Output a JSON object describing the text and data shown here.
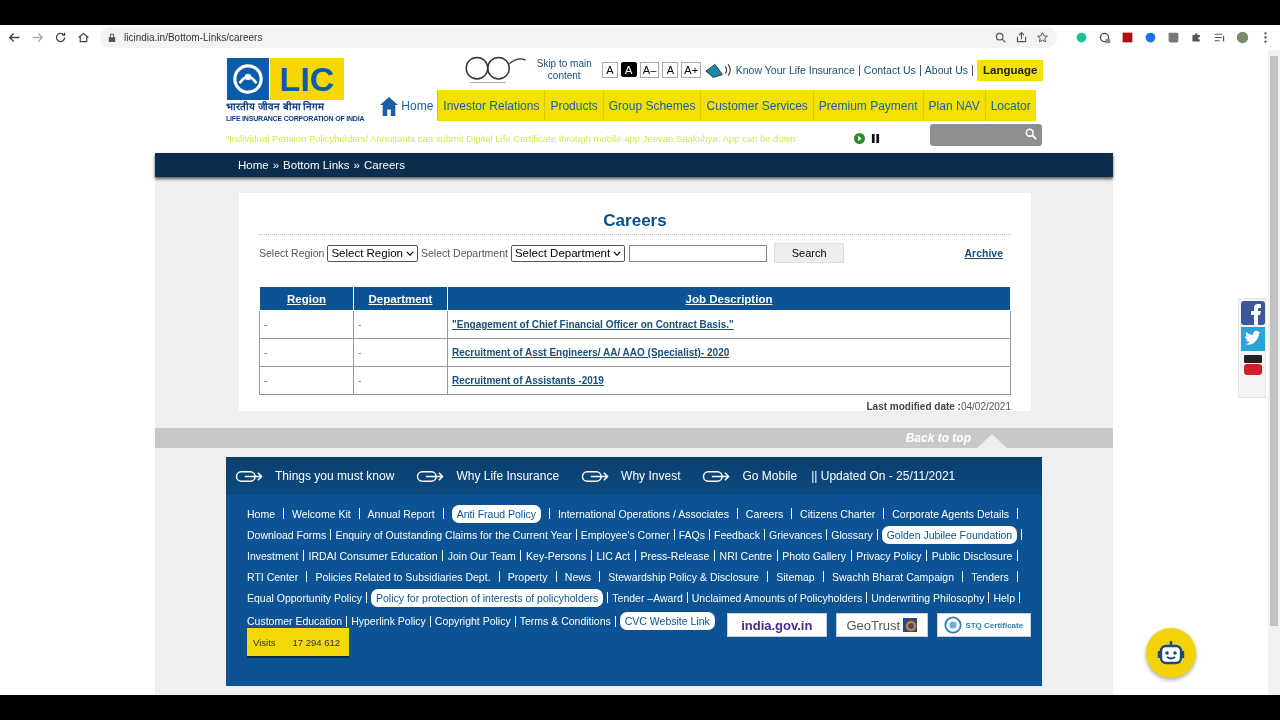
{
  "browser": {
    "url": "licindia.in/Bottom-Links/careers"
  },
  "header": {
    "logo": {
      "brand": "LIC",
      "hindi": "भारतीय जीवन बीमा निगम",
      "english": "LIFE INSURANCE CORPORATION OF INDIA"
    },
    "skip_link": "Skip to main content",
    "font_sizes": [
      {
        "label": "A",
        "selected": false
      },
      {
        "label": "A",
        "selected": true
      },
      {
        "label": "A–",
        "selected": false
      },
      {
        "label": "A",
        "selected": false
      },
      {
        "label": "A+",
        "selected": false
      }
    ],
    "top_links": [
      "Know Your Life Insurance",
      "Contact Us",
      "About Us"
    ],
    "language_button": "Language",
    "nav": [
      {
        "label": "Home",
        "kind": "home"
      },
      {
        "label": "Investor Relations",
        "kind": "tab"
      },
      {
        "label": "Products",
        "kind": "tab"
      },
      {
        "label": "Group Schemes",
        "kind": "tab"
      },
      {
        "label": "Customer Services",
        "kind": "tab"
      },
      {
        "label": "Premium Payment",
        "kind": "tab"
      },
      {
        "label": "Plan NAV",
        "kind": "tab"
      },
      {
        "label": "Locator",
        "kind": "tab"
      }
    ],
    "marquee": "“Individual Pension Policyholders/ Annuitants can submit Digital Life Certificate through mobile app Jeevan Saakshya. App can be down"
  },
  "breadcrumb": {
    "items": [
      "Home",
      "Bottom Links",
      "Careers"
    ],
    "separator": "»"
  },
  "careers": {
    "title": "Careers",
    "region_label": "Select Region",
    "region_select": "Select Region",
    "department_label": "Select Department",
    "department_select": "Select Department",
    "search_button": "Search",
    "archive_link": "Archive",
    "columns": [
      "Region",
      "Department",
      "Job Description"
    ],
    "rows": [
      {
        "region": "-",
        "department": "-",
        "job": "\"Engagement of Chief Financial Officer on Contract Basis.\""
      },
      {
        "region": "-",
        "department": "-",
        "job": "Recruitment of Asst Engineers/ AA/ AAO (Specialist)- 2020"
      },
      {
        "region": "-",
        "department": "-",
        "job": "Recruitment of Assistants -2019"
      }
    ],
    "last_modified_label": "Last modified date :",
    "last_modified": "04/02/2021"
  },
  "back_to_top": "Back to top",
  "footer": {
    "quick_links": [
      "Things you must know",
      "Why Life Insurance",
      "Why Invest",
      "Go Mobile"
    ],
    "updated": "|| Updated On - 25/11/2021",
    "link_rows": [
      [
        {
          "label": "Home",
          "highlighted": false
        },
        {
          "label": "Welcome Kit",
          "highlighted": false
        },
        {
          "label": "Annual Report",
          "highlighted": false
        },
        {
          "label": "Anti Fraud Policy",
          "highlighted": true
        },
        {
          "label": "International Operations / Associates",
          "highlighted": false
        },
        {
          "label": "Careers",
          "highlighted": false
        },
        {
          "label": "Citizens Charter",
          "highlighted": false
        },
        {
          "label": "Corporate Agents Details",
          "highlighted": false
        }
      ],
      [
        {
          "label": "Download Forms",
          "highlighted": false
        },
        {
          "label": "Enquiry of Outstanding Claims for the Current Year",
          "highlighted": false
        },
        {
          "label": "Employee's Corner",
          "highlighted": false
        },
        {
          "label": "FAQs",
          "highlighted": false
        },
        {
          "label": "Feedback",
          "highlighted": false
        },
        {
          "label": "Grievances",
          "highlighted": false
        },
        {
          "label": "Glossary",
          "highlighted": false
        },
        {
          "label": "Golden Jubilee Foundation",
          "highlighted": true
        }
      ],
      [
        {
          "label": "Investment",
          "highlighted": false
        },
        {
          "label": "IRDAI Consumer Education",
          "highlighted": false
        },
        {
          "label": "Join Our Team",
          "highlighted": false
        },
        {
          "label": "Key-Persons",
          "highlighted": false
        },
        {
          "label": "LIC Act",
          "highlighted": false
        },
        {
          "label": "Press-Release",
          "highlighted": false
        },
        {
          "label": "NRI Centre",
          "highlighted": false
        },
        {
          "label": "Photo Gallery",
          "highlighted": false
        },
        {
          "label": "Privacy Policy",
          "highlighted": false
        },
        {
          "label": "Public Disclosure",
          "highlighted": false
        }
      ],
      [
        {
          "label": "RTI Center",
          "highlighted": false
        },
        {
          "label": "Policies Related to Subsidiaries Dept.",
          "highlighted": false
        },
        {
          "label": "Property",
          "highlighted": false
        },
        {
          "label": "News",
          "highlighted": false
        },
        {
          "label": "Stewardship Policy & Disclosure",
          "highlighted": false
        },
        {
          "label": "Sitemap",
          "highlighted": false
        },
        {
          "label": "Swachh Bharat Campaign",
          "highlighted": false
        },
        {
          "label": "Tenders",
          "highlighted": false
        }
      ],
      [
        {
          "label": "Equal Opportunity Policy",
          "highlighted": false
        },
        {
          "label": "Policy for protection of interests of policyholders",
          "highlighted": true
        },
        {
          "label": "Tender –Award",
          "highlighted": false
        },
        {
          "label": "Unclaimed Amounts of Policyholders",
          "highlighted": false
        },
        {
          "label": "Underwriting Philosophy",
          "highlighted": false
        },
        {
          "label": "Help",
          "highlighted": false
        }
      ],
      [
        {
          "label": "Customer Education",
          "highlighted": false
        },
        {
          "label": "Hyperlink Policy",
          "highlighted": false
        },
        {
          "label": "Copyright Policy",
          "highlighted": false
        },
        {
          "label": "Terms & Conditions",
          "highlighted": false
        },
        {
          "label": "CVC Website Link",
          "highlighted": true
        }
      ]
    ],
    "visits": {
      "label": "Visits",
      "count": "17 294 612"
    },
    "badges": [
      {
        "kind": "india_gov",
        "text": "india.gov.in"
      },
      {
        "kind": "geotrust",
        "text": "GeoTrust"
      },
      {
        "kind": "stq",
        "text": "STQ Certificate"
      }
    ]
  }
}
